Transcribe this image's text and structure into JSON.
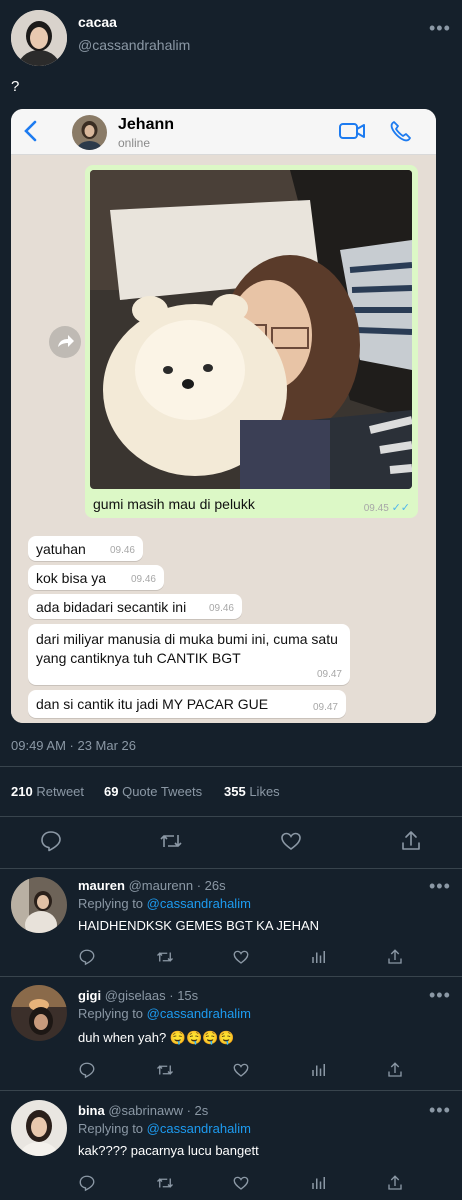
{
  "tweet": {
    "display_name": "cacaa",
    "handle": "@cassandrahalim",
    "text": "?",
    "timestamp": "09:49 AM · 23 Mar 26",
    "stats": {
      "retweets_count": "210",
      "retweets_label": "Retweet",
      "quotes_count": "69",
      "quotes_label": "Quote Tweets",
      "likes_count": "355",
      "likes_label": "Likes"
    }
  },
  "chat": {
    "contact_name": "Jehann",
    "status": "online",
    "image_caption": "gumi masih mau di pelukk",
    "image_time": "09.45",
    "messages": [
      {
        "text": "yatuhan",
        "time": "09.46"
      },
      {
        "text": "kok bisa ya",
        "time": "09.46"
      },
      {
        "text": "ada bidadari secantik ini",
        "time": "09.46"
      },
      {
        "text": "dari miliyar manusia di muka bumi ini, cuma satu yang cantiknya tuh CANTIK BGT",
        "time": "09.47"
      },
      {
        "text": "dan si cantik itu jadi MY PACAR GUE",
        "time": "09.47"
      }
    ]
  },
  "replies": [
    {
      "name": "mauren",
      "handle": "@maurenn",
      "time": "· 26s",
      "replying_label": "Replying to",
      "replying_to": "@cassandrahalim",
      "text": "HAIDHENDKSK GEMES BGT KA JEHAN"
    },
    {
      "name": "gigi",
      "handle": "@giselaas",
      "time": "· 15s",
      "replying_label": "Replying to",
      "replying_to": "@cassandrahalim",
      "text": "duh when yah? 🤤🤤🤤🤤"
    },
    {
      "name": "bina",
      "handle": "@sabrinaww",
      "time": "· 2s",
      "replying_label": "Replying to",
      "replying_to": "@cassandrahalim",
      "text": "kak???? pacarnya lucu bangett"
    }
  ],
  "colors": {
    "background": "#15202b",
    "accent": "#1d9bf0",
    "muted": "#8b98a5",
    "wa_bubble_out": "#dcf8c6"
  }
}
